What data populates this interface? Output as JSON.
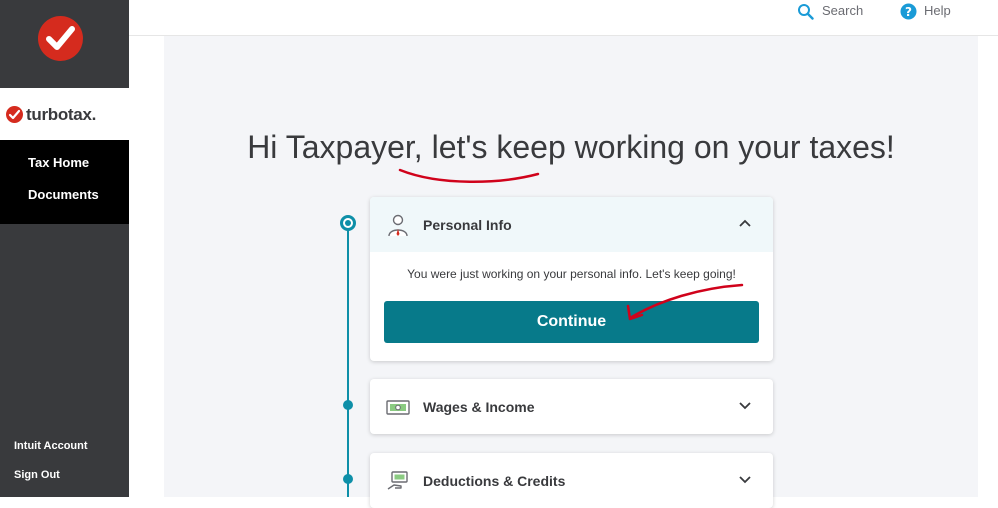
{
  "brand": {
    "name": "turbotax."
  },
  "sidebar": {
    "nav": [
      {
        "label": "Tax Home"
      },
      {
        "label": "Documents"
      }
    ],
    "footer": [
      {
        "label": "Intuit Account"
      },
      {
        "label": "Sign Out"
      }
    ]
  },
  "topbar": {
    "search_label": "Search",
    "help_label": "Help"
  },
  "main": {
    "headline": "Hi Taxpayer, let's keep working on your taxes!",
    "sections": [
      {
        "title": "Personal Info",
        "icon": "person-icon",
        "expanded": true,
        "message": "You were just working on your personal info. Let's keep going!",
        "button_label": "Continue"
      },
      {
        "title": "Wages & Income",
        "icon": "money-icon",
        "expanded": false
      },
      {
        "title": "Deductions & Credits",
        "icon": "money-hand-icon",
        "expanded": false
      }
    ]
  },
  "colors": {
    "sidebar": "#393a3d",
    "accent": "#0e8fa8",
    "button": "#077a8a",
    "brand_red": "#d52b1e",
    "annotation": "#d0021b"
  }
}
